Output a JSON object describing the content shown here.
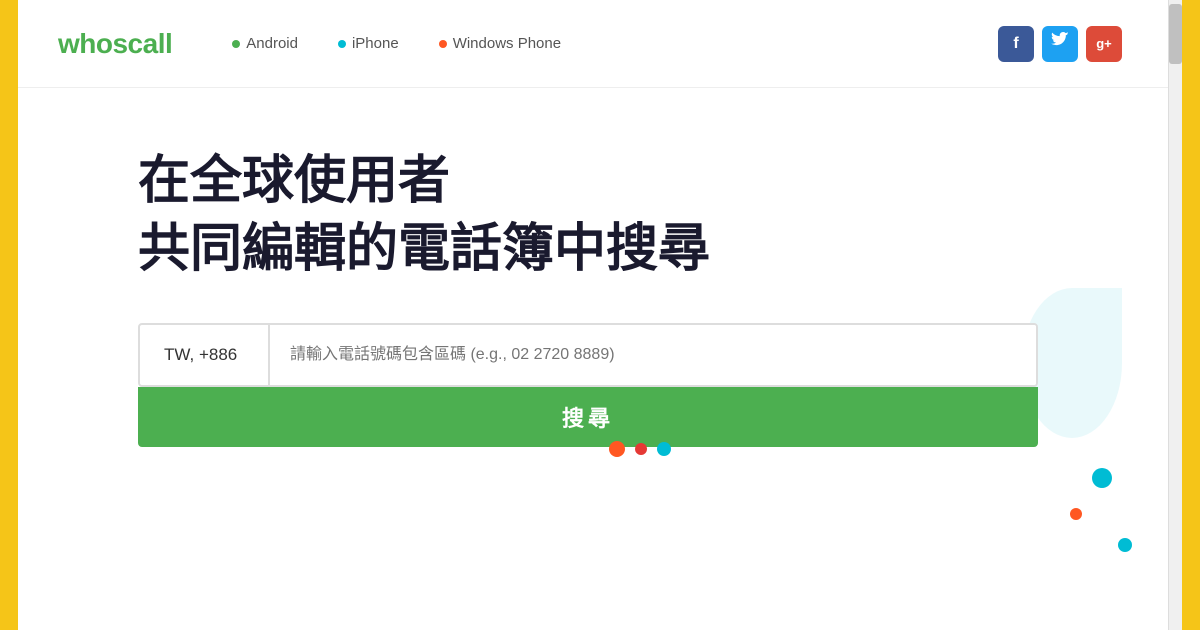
{
  "header": {
    "logo": "whoscall",
    "nav": {
      "android_label": "Android",
      "iphone_label": "iPhone",
      "windows_phone_label": "Windows Phone"
    },
    "social": {
      "facebook_label": "f",
      "twitter_label": "t",
      "googleplus_label": "g+"
    }
  },
  "hero": {
    "title_line1": "在全球使用者",
    "title_line2": "共同編輯的電話簿中搜尋",
    "country_code": "TW, +886",
    "search_placeholder": "請輸入電話號碼包含區碼 (e.g., 02 2720 8889)",
    "search_button_label": "搜尋"
  },
  "colors": {
    "logo_green": "#4caf50",
    "dot_green": "#4caf50",
    "dot_cyan": "#00bcd4",
    "dot_orange": "#ff5722",
    "fb_blue": "#3b5998",
    "tw_blue": "#1da1f2",
    "gp_red": "#dd4b39",
    "search_btn_green": "#4caf50"
  }
}
